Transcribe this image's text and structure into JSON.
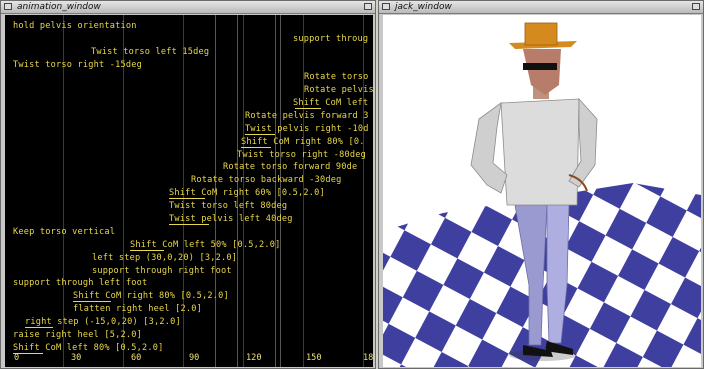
{
  "animation_window": {
    "title": "animation_window",
    "commands": [
      "hold pelvis orientation",
      "support throug",
      "Twist torso left 15deg",
      "Twist torso right -15deg",
      "Rotate torso",
      "Rotate pelvis",
      "Shift CoM left",
      "Rotate pelvis forward 3",
      "Twist pelvis right -10d",
      "Shift CoM right 80% [0.",
      "Twist torso right -80deg",
      "Rotate torso forward 90de",
      "Rotate torso backward -30deg",
      "Shift CoM right 60% [0.5,2.0]",
      "Twist torso left 80deg",
      "Twist pelvis left 40deg",
      "Keep torso vertical",
      "Shift CoM left 50% [0.5,2.0]",
      "left step (30,0,20) [3,2.0]",
      "support through right foot",
      "support through left foot",
      "Shift CoM right 80% [0.5,2.0]",
      "flatten right heel [2.0]",
      "right step (-15,0,20) [3,2.0]",
      "raise right heel [5,2.0]",
      "Shift CoM left 80% [0.5,2.0]"
    ],
    "axis_ticks": [
      "0",
      "30",
      "60",
      "90",
      "120",
      "150",
      "18"
    ]
  },
  "jack_window": {
    "title": "jack_window",
    "colors": {
      "floor_a": "#3f3fa0",
      "floor_b": "#ffffff",
      "hat": "#d58a1e",
      "shirt": "#d8d8d8",
      "pants": "#9a9ad0"
    }
  }
}
